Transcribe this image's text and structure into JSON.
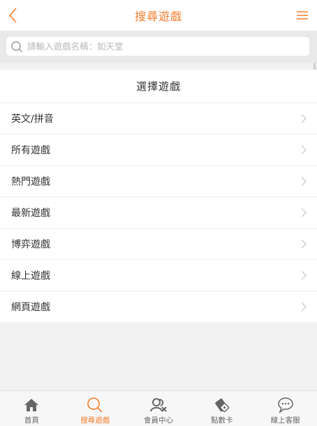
{
  "header": {
    "title": "搜尋遊戲",
    "back_icon": "chevron-left-icon",
    "menu_icon": "hamburger-menu-icon"
  },
  "search": {
    "placeholder": "請輸入遊戲名稱：如天堂",
    "value": ""
  },
  "list": {
    "heading": "選擇遊戲",
    "items": [
      {
        "label": "英文/拼音"
      },
      {
        "label": "所有遊戲"
      },
      {
        "label": "熱門遊戲"
      },
      {
        "label": "最新遊戲"
      },
      {
        "label": "博弈遊戲"
      },
      {
        "label": "線上遊戲"
      },
      {
        "label": "網頁遊戲"
      }
    ]
  },
  "tabs": [
    {
      "label": "首頁",
      "icon": "home-icon",
      "active": false
    },
    {
      "label": "搜尋遊戲",
      "icon": "search-icon",
      "active": true
    },
    {
      "label": "會員中心",
      "icon": "member-icon",
      "active": false
    },
    {
      "label": "點數卡",
      "icon": "point-card-icon",
      "active": false
    },
    {
      "label": "線上客服",
      "icon": "chat-bubble-icon",
      "active": false
    }
  ],
  "colors": {
    "accent": "#f47c2b",
    "background": "#f1f1f1",
    "search_bg": "#e9e9e9",
    "icon_gray": "#666666"
  }
}
